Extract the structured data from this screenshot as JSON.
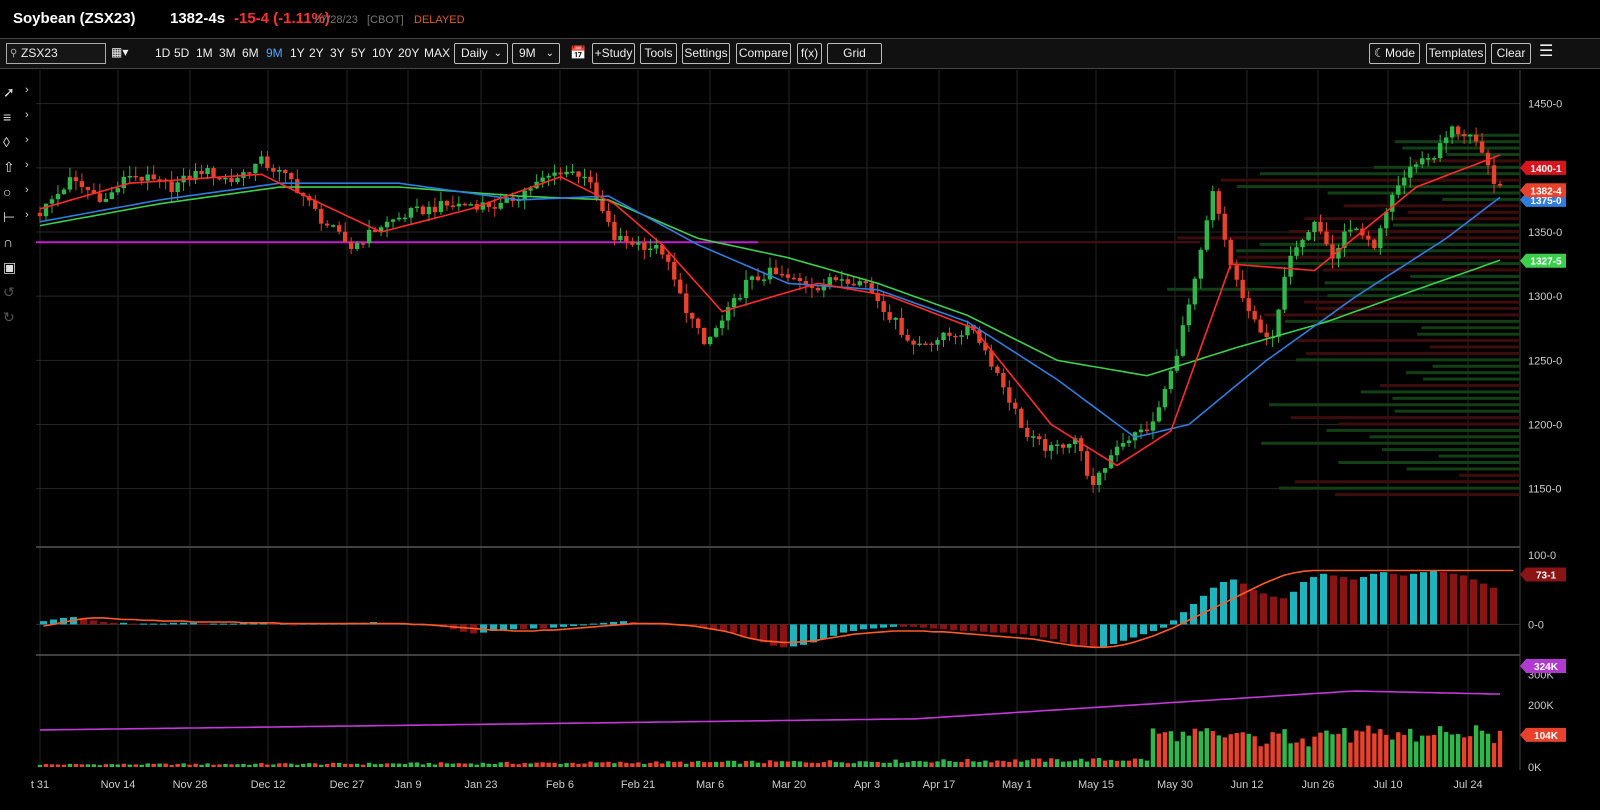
{
  "header": {
    "symbol": "Soybean (ZSX23)",
    "price": "1382-4s",
    "change": "-15-4 (-1.11%)",
    "date": "07/28/23",
    "exchange": "[CBOT]",
    "status": "DELAYED"
  },
  "toolbar": {
    "symbol_input": "ZSX23",
    "periods": [
      "1D",
      "5D",
      "1M",
      "3M",
      "6M",
      "9M",
      "1Y",
      "2Y",
      "3Y",
      "5Y",
      "10Y",
      "20Y",
      "MAX"
    ],
    "active_period": "9M",
    "interval_select": "Daily",
    "range_select": "9M",
    "study_label": "+Study",
    "tools_label": "Tools",
    "settings_label": "Settings",
    "compare_label": "Compare",
    "fx_label": "f(x)",
    "grid_label": "Grid",
    "mode_label": "Mode",
    "templates_label": "Templates",
    "clear_label": "Clear"
  },
  "colors": {
    "up": "#2fb84a",
    "down": "#e8412c",
    "ma_red": "#ff2a2a",
    "ma_blue": "#2e7de0",
    "ma_green": "#3ccf4e",
    "support": "#c41ccf",
    "volume_avg": "#c13ad6",
    "hist_cyan": "#1fb3bd",
    "hist_red": "#8a1414",
    "macd_line": "#ff5a2a"
  },
  "chart_data": [
    {
      "type": "candlestick",
      "x_labels": [
        "t 31",
        "Nov 14",
        "Nov 28",
        "Dec 12",
        "Dec 27",
        "Jan 9",
        "Jan 23",
        "Feb 6",
        "Feb 21",
        "Mar 6",
        "Mar 20",
        "Apr 3",
        "Apr 17",
        "May 1",
        "May 15",
        "May 30",
        "Jun 12",
        "Jun 26",
        "Jul 10",
        "Jul 24"
      ],
      "y_ticks": [
        "1450-0",
        "1400-0",
        "1350-0",
        "1300-0",
        "1250-0",
        "1200-0",
        "1150-0"
      ],
      "ylim": [
        1110,
        1470
      ],
      "last_price_label": "1382-4",
      "ma_labels": [
        "1400-1",
        "1375-0",
        "1327-5"
      ],
      "price_path": [
        [
          0,
          1365
        ],
        [
          5,
          1390
        ],
        [
          11,
          1375
        ],
        [
          15,
          1395
        ],
        [
          22,
          1385
        ],
        [
          27,
          1398
        ],
        [
          32,
          1390
        ],
        [
          37,
          1405
        ],
        [
          42,
          1390
        ],
        [
          47,
          1360
        ],
        [
          52,
          1338
        ],
        [
          57,
          1355
        ],
        [
          62,
          1365
        ],
        [
          67,
          1370
        ],
        [
          72,
          1372
        ],
        [
          77,
          1370
        ],
        [
          82,
          1385
        ],
        [
          87,
          1398
        ],
        [
          91,
          1395
        ],
        [
          96,
          1345
        ],
        [
          101,
          1340
        ],
        [
          104,
          1335
        ],
        [
          107,
          1300
        ],
        [
          111,
          1262
        ],
        [
          114,
          1280
        ],
        [
          118,
          1310
        ],
        [
          122,
          1318
        ],
        [
          126,
          1312
        ],
        [
          130,
          1308
        ],
        [
          134,
          1315
        ],
        [
          138,
          1310
        ],
        [
          142,
          1285
        ],
        [
          146,
          1262
        ],
        [
          151,
          1268
        ],
        [
          156,
          1275
        ],
        [
          160,
          1240
        ],
        [
          165,
          1190
        ],
        [
          169,
          1180
        ],
        [
          173,
          1190
        ],
        [
          176,
          1150
        ],
        [
          180,
          1185
        ],
        [
          183,
          1192
        ],
        [
          186,
          1200
        ],
        [
          189,
          1240
        ],
        [
          193,
          1310
        ],
        [
          196,
          1380
        ],
        [
          199,
          1325
        ],
        [
          202,
          1285
        ],
        [
          206,
          1265
        ],
        [
          209,
          1335
        ],
        [
          213,
          1360
        ],
        [
          216,
          1330
        ],
        [
          219,
          1355
        ],
        [
          223,
          1335
        ],
        [
          226,
          1380
        ],
        [
          230,
          1405
        ],
        [
          233,
          1410
        ],
        [
          236,
          1430
        ],
        [
          239,
          1425
        ],
        [
          242,
          1400
        ],
        [
          244,
          1382
        ]
      ],
      "ma_red_path": [
        [
          0,
          1368
        ],
        [
          15,
          1388
        ],
        [
          37,
          1395
        ],
        [
          47,
          1372
        ],
        [
          57,
          1350
        ],
        [
          72,
          1368
        ],
        [
          87,
          1393
        ],
        [
          96,
          1372
        ],
        [
          104,
          1340
        ],
        [
          114,
          1288
        ],
        [
          130,
          1310
        ],
        [
          142,
          1300
        ],
        [
          156,
          1275
        ],
        [
          169,
          1200
        ],
        [
          180,
          1168
        ],
        [
          189,
          1195
        ],
        [
          199,
          1325
        ],
        [
          213,
          1320
        ],
        [
          230,
          1385
        ],
        [
          244,
          1410
        ]
      ],
      "ma_blue_path": [
        [
          0,
          1358
        ],
        [
          20,
          1375
        ],
        [
          40,
          1388
        ],
        [
          60,
          1388
        ],
        [
          80,
          1375
        ],
        [
          95,
          1378
        ],
        [
          110,
          1340
        ],
        [
          125,
          1310
        ],
        [
          140,
          1305
        ],
        [
          155,
          1280
        ],
        [
          170,
          1235
        ],
        [
          183,
          1190
        ],
        [
          192,
          1200
        ],
        [
          205,
          1250
        ],
        [
          220,
          1300
        ],
        [
          235,
          1345
        ],
        [
          244,
          1377
        ]
      ],
      "ma_green_path": [
        [
          0,
          1355
        ],
        [
          20,
          1372
        ],
        [
          40,
          1385
        ],
        [
          60,
          1385
        ],
        [
          80,
          1378
        ],
        [
          95,
          1375
        ],
        [
          110,
          1345
        ],
        [
          125,
          1330
        ],
        [
          140,
          1310
        ],
        [
          155,
          1285
        ],
        [
          170,
          1250
        ],
        [
          185,
          1238
        ],
        [
          200,
          1260
        ],
        [
          215,
          1280
        ],
        [
          230,
          1305
        ],
        [
          244,
          1328
        ]
      ],
      "support_level": 1342
    },
    {
      "type": "bar",
      "name": "MACD histogram",
      "y_ticks": [
        "100-0",
        "0-0"
      ],
      "last_label": "73-1",
      "hist": [
        4,
        6,
        8,
        9,
        7,
        5,
        3,
        2,
        2,
        1,
        1,
        1,
        1,
        2,
        2,
        2,
        1,
        1,
        1,
        1,
        2,
        2,
        2,
        1,
        1,
        0,
        1,
        1,
        1,
        1,
        1,
        2,
        2,
        3,
        2,
        1,
        1,
        0,
        0,
        -1,
        -3,
        -6,
        -9,
        -11,
        -10,
        -8,
        -7,
        -6,
        -6,
        -5,
        -5,
        -4,
        -3,
        -2,
        -1,
        1,
        2,
        3,
        4,
        3,
        2,
        1,
        0,
        -1,
        -2,
        -3,
        -4,
        -6,
        -8,
        -10,
        -14,
        -18,
        -22,
        -26,
        -28,
        -27,
        -25,
        -22,
        -18,
        -14,
        -10,
        -8,
        -6,
        -5,
        -4,
        -3,
        -3,
        -3,
        -4,
        -5,
        -6,
        -7,
        -8,
        -8,
        -9,
        -10,
        -10,
        -11,
        -12,
        -14,
        -16,
        -18,
        -22,
        -25,
        -27,
        -28,
        -27,
        -24,
        -20,
        -16,
        -12,
        -8,
        -4,
        5,
        15,
        25,
        35,
        45,
        52,
        55,
        50,
        42,
        38,
        34,
        32,
        40,
        52,
        58,
        62,
        60,
        58,
        55,
        58,
        62,
        64,
        62,
        60,
        62,
        64,
        66,
        64,
        62,
        60,
        55,
        50,
        45
      ],
      "line": [
        -2,
        0,
        3,
        5,
        7,
        8,
        8,
        7,
        6,
        6,
        5,
        5,
        4,
        4,
        4,
        3,
        3,
        3,
        3,
        3,
        2,
        2,
        2,
        2,
        1,
        1,
        1,
        1,
        1,
        1,
        1,
        1,
        1,
        1,
        1,
        1,
        1,
        0,
        0,
        -1,
        -2,
        -3,
        -4,
        -5,
        -6,
        -7,
        -7,
        -8,
        -8,
        -8,
        -7,
        -7,
        -6,
        -5,
        -4,
        -3,
        -2,
        -1,
        0,
        1,
        1,
        1,
        1,
        0,
        -1,
        -2,
        -4,
        -6,
        -8,
        -11,
        -15,
        -18,
        -20,
        -21,
        -22,
        -22,
        -21,
        -20,
        -18,
        -16,
        -14,
        -12,
        -11,
        -10,
        -9,
        -8,
        -8,
        -8,
        -8,
        -9,
        -9,
        -10,
        -11,
        -12,
        -13,
        -14,
        -15,
        -16,
        -17,
        -18,
        -20,
        -22,
        -24,
        -26,
        -27,
        -28,
        -28,
        -27,
        -25,
        -22,
        -18,
        -14,
        -9,
        -4,
        2,
        8,
        14,
        20,
        26,
        32,
        38,
        44,
        50,
        55,
        60,
        63,
        65,
        66,
        66,
        66,
        66,
        66,
        66,
        66,
        66,
        66,
        66,
        66,
        66,
        66,
        66,
        66,
        66,
        66,
        66,
        66,
        66,
        66
      ],
      "ylim": [
        -35,
        85
      ]
    },
    {
      "type": "bar",
      "name": "Volume",
      "y_ticks": [
        "300K",
        "200K",
        "100K",
        "0K"
      ],
      "last_label": "104K",
      "avg_label": "324K",
      "ylim": [
        0,
        340000
      ]
    }
  ]
}
